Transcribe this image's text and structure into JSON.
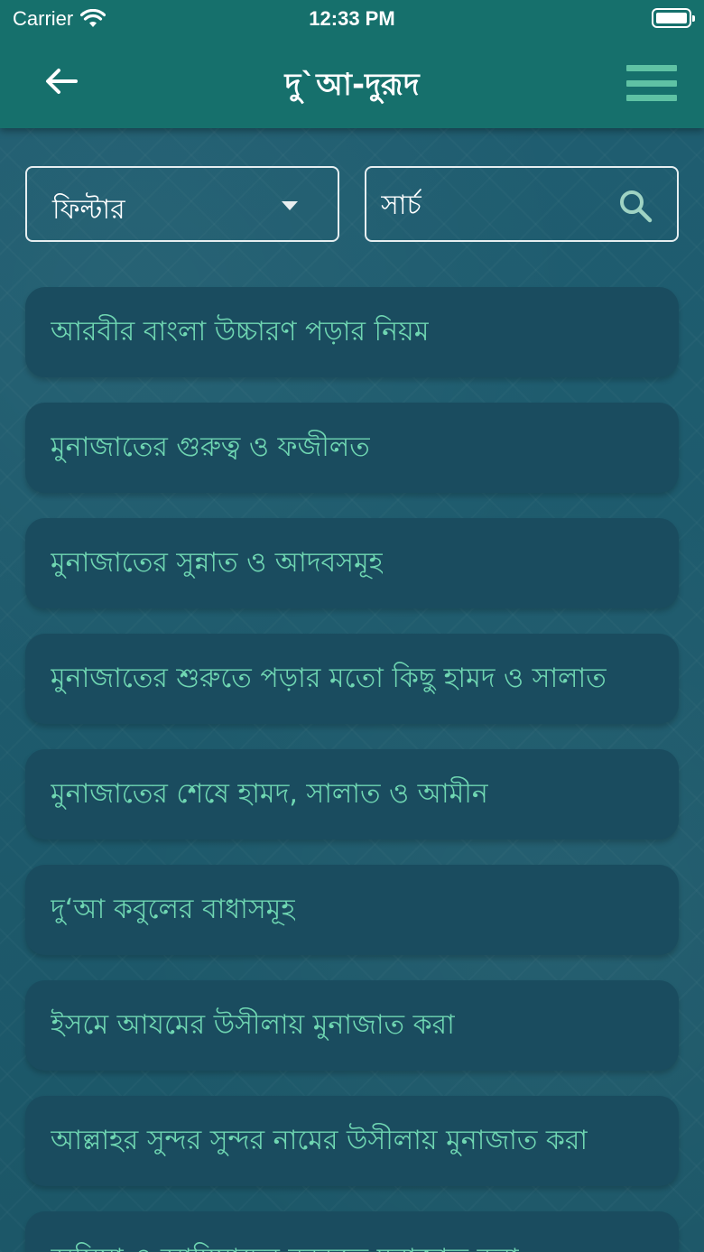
{
  "status": {
    "carrier": "Carrier",
    "time": "12:33 PM"
  },
  "header": {
    "title": "দু`আ-দুরূদ",
    "icons": {
      "back": "arrow-left-icon",
      "menu": "hamburger-menu-icon"
    }
  },
  "filter": {
    "label": "ফিল্টার",
    "icon": "chevron-down-icon"
  },
  "search": {
    "placeholder": "সার্চ",
    "value": "",
    "icon": "search-icon"
  },
  "list": {
    "items": [
      {
        "label": "আরবীর বাংলা উচ্চারণ পড়ার নিয়ম"
      },
      {
        "label": "মুনাজাতের গুরুত্ব ও ফজীলত"
      },
      {
        "label": "মুনাজাতের সুন্নাত ও আদবসমূহ"
      },
      {
        "label": "মুনাজাতের শুরুতে পড়ার মতো কিছু হামদ ও সালাত"
      },
      {
        "label": "মুনাজাতের শেষে হামদ, সালাত ও আমীন"
      },
      {
        "label": "দু‘আ কবুলের বাধাসমূহ"
      },
      {
        "label": "ইসমে আযমের উসীলায় মুনাজাত করা"
      },
      {
        "label": "আল্লাহর সুন্দর সুন্দর নামের উসীলায় মুনাজাত করা"
      },
      {
        "label": "অসিয়া ও আম্বিয়াদের বরকতে মুনাজাত করা"
      }
    ]
  },
  "colors": {
    "header_bg": "#16706c",
    "page_bg": "#1e5c6e",
    "item_bg": "#1a4c5f",
    "item_text": "#6fd6b2",
    "menu_icon": "#5fc2a4"
  }
}
